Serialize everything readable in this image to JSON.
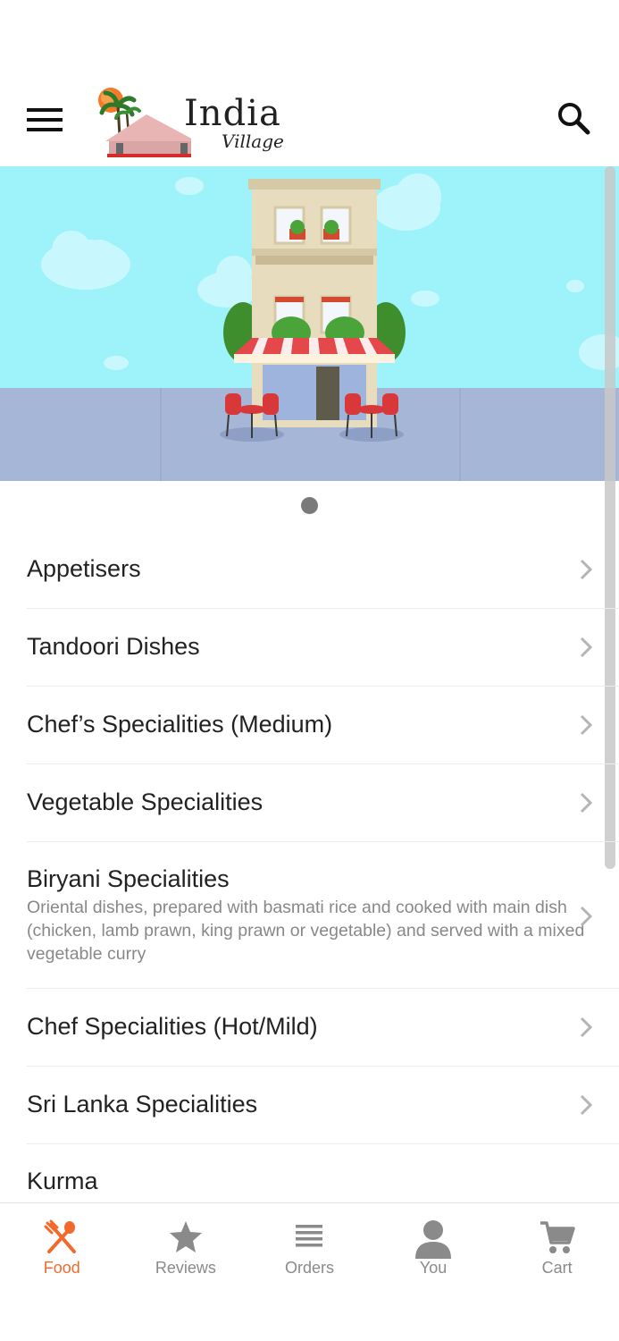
{
  "header": {
    "logo_word_1": "India",
    "logo_word_2": "Village",
    "menu_icon": "hamburger-icon",
    "search_icon": "search-icon"
  },
  "colors": {
    "accent": "#f26a2b",
    "inactive": "#8a8a8a",
    "sky": "#9ef3fb",
    "ground": "#a6b6d6"
  },
  "carousel": {
    "slide_count": 1,
    "active_index": 0
  },
  "categories": [
    {
      "title": "Appetisers"
    },
    {
      "title": "Tandoori Dishes"
    },
    {
      "title": "Chef’s Specialities (Medium)"
    },
    {
      "title": "Vegetable Specialities"
    },
    {
      "title": "Biryani Specialities",
      "description": "Oriental dishes, prepared with basmati rice and cooked with main dish (chicken, lamb prawn, king prawn or vegetable) and served with a mixed vegetable curry"
    },
    {
      "title": "Chef Specialities (Hot/Mild)"
    },
    {
      "title": "Sri Lanka Specialities"
    },
    {
      "title": "Kurma"
    }
  ],
  "bottom_nav": [
    {
      "label": "Food",
      "icon": "fork-spoon-icon",
      "active": true
    },
    {
      "label": "Reviews",
      "icon": "star-icon",
      "active": false
    },
    {
      "label": "Orders",
      "icon": "list-icon",
      "active": false
    },
    {
      "label": "You",
      "icon": "person-icon",
      "active": false
    },
    {
      "label": "Cart",
      "icon": "cart-icon",
      "active": false
    }
  ]
}
